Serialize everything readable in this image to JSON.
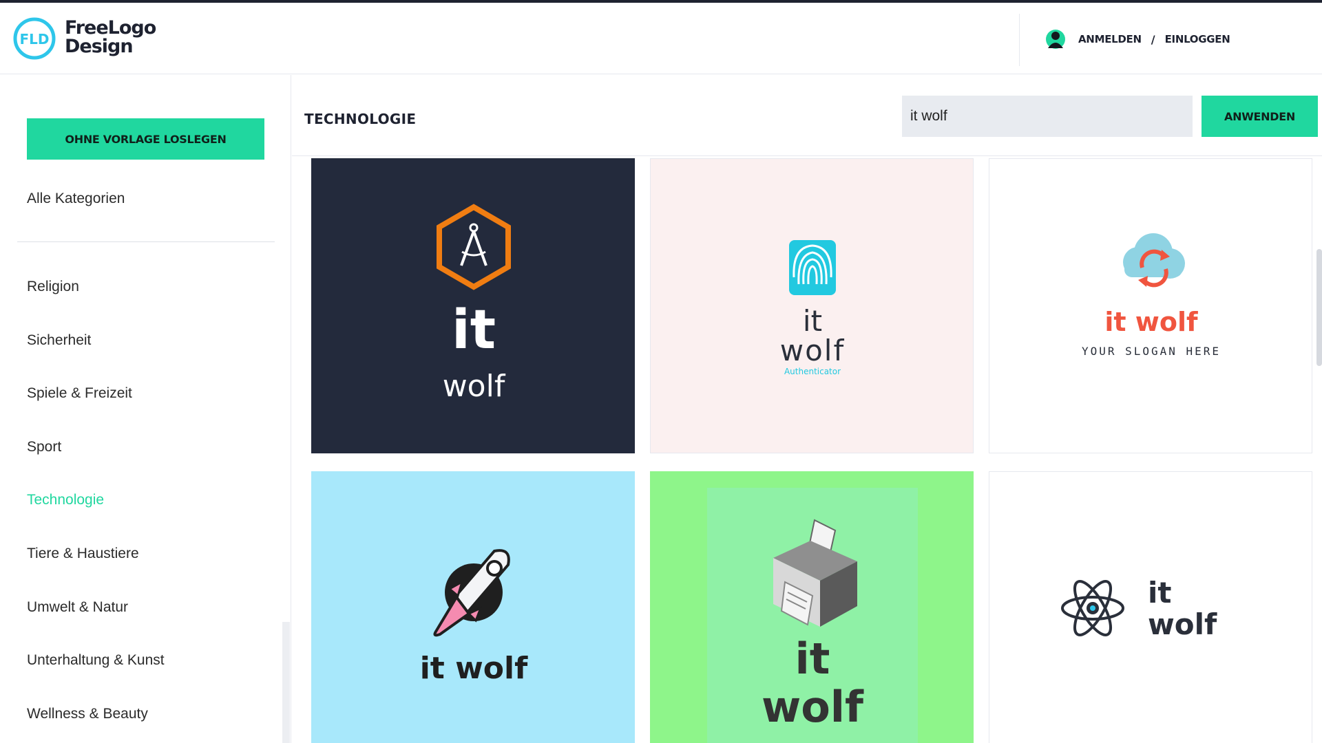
{
  "header": {
    "logo_abbr": "FLD",
    "logo_line1": "FreeLogo",
    "logo_line2": "Design",
    "register_label": "ANMELDEN",
    "separator": "/",
    "login_label": "EINLOGGEN"
  },
  "sidebar": {
    "start_button": "OHNE VORLAGE LOSLEGEN",
    "all_categories": "Alle Kategorien",
    "categories": [
      {
        "label": "Religion"
      },
      {
        "label": "Sicherheit"
      },
      {
        "label": "Spiele & Freizeit"
      },
      {
        "label": "Sport"
      },
      {
        "label": "Technologie",
        "active": true
      },
      {
        "label": "Tiere & Haustiere"
      },
      {
        "label": "Umwelt & Natur"
      },
      {
        "label": "Unterhaltung & Kunst"
      },
      {
        "label": "Wellness & Beauty"
      }
    ]
  },
  "main": {
    "section_title": "TECHNOLOGIE",
    "search_value": "it wolf",
    "apply_button": "ANWENDEN"
  },
  "logos": [
    {
      "icon": "hexagon-compass-icon",
      "bg": "#232a3c",
      "text1": "it",
      "text2": "wolf"
    },
    {
      "icon": "fingerprint-icon",
      "bg": "#fbf0f0",
      "text1": "it",
      "text2": "wolf",
      "tagline": "Authenticator"
    },
    {
      "icon": "cloud-sync-icon",
      "bg": "#ffffff",
      "text1": "it wolf",
      "tagline": "YOUR SLOGAN HERE"
    },
    {
      "icon": "rocket-icon",
      "bg": "#a8e8fb",
      "text1": "it wolf"
    },
    {
      "icon": "printer-icon",
      "bg": "#8ef58a",
      "text1": "it",
      "text2": "wolf"
    },
    {
      "icon": "atom-icon",
      "bg": "#ffffff",
      "text1": "it",
      "text2": "wolf"
    }
  ],
  "colors": {
    "accent": "#20d79f",
    "dark": "#1e2230"
  }
}
